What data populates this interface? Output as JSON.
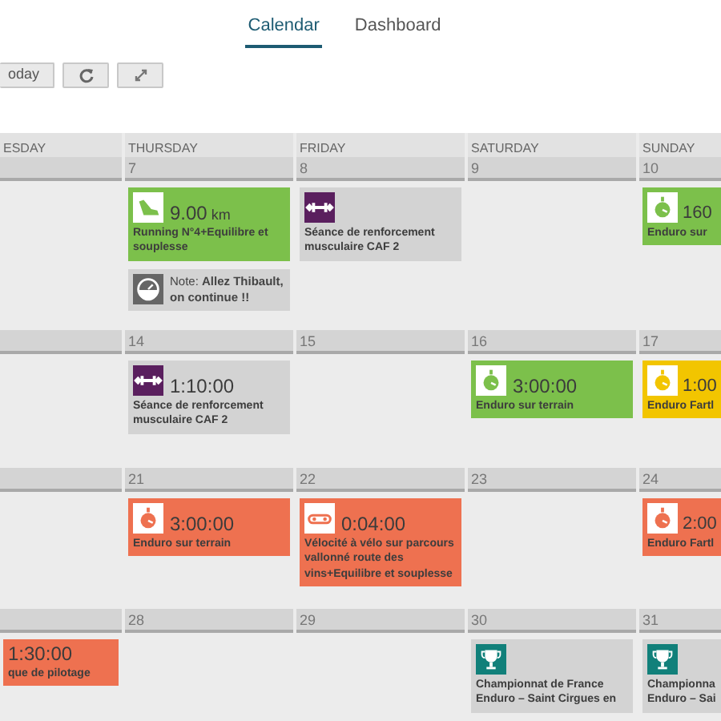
{
  "tabs": [
    {
      "label": "Calendar",
      "selected": true
    },
    {
      "label": "Dashboard",
      "selected": false
    }
  ],
  "toolbar": {
    "today_button": "oday"
  },
  "day_headers": [
    "ESDAY",
    "THURSDAY",
    "FRIDAY",
    "SATURDAY",
    "SUNDAY"
  ],
  "weeks": [
    {
      "days": [
        {
          "date": "7",
          "events": [
            {
              "kind": "running",
              "color": "#7cc04b",
              "value": "9.00",
              "unit": "km",
              "title": "Running N°4+Equilibre et souplesse"
            },
            {
              "kind": "note",
              "color": "#d3d3d3",
              "title": "Note: **Allez Thibault, on continue !!**"
            }
          ]
        },
        {
          "date": "8",
          "events": [
            {
              "kind": "strength",
              "color": "#d3d3d3",
              "title": "Séance de renforcement musculaire CAF 2"
            }
          ]
        },
        {
          "date": "9"
        },
        {
          "date": "10",
          "events": [
            {
              "kind": "enduro",
              "color": "#7cc04b",
              "value": "160",
              "title": "Enduro sur"
            }
          ]
        }
      ]
    },
    {
      "days": [
        {
          "date": "14",
          "events": [
            {
              "kind": "strength",
              "color": "#d3d3d3",
              "value": "1:10:00",
              "title": "Séance de renforcement musculaire CAF 2"
            }
          ]
        },
        {
          "date": "15"
        },
        {
          "date": "16",
          "events": [
            {
              "kind": "enduro",
              "color": "#7cc04b",
              "value": "3:00:00",
              "title": "Enduro sur terrain"
            }
          ]
        },
        {
          "date": "17",
          "events": [
            {
              "kind": "enduro",
              "color": "#f2c500",
              "value": "1:00",
              "title": "Enduro Fartl"
            }
          ]
        }
      ]
    },
    {
      "days": [
        {
          "date": "21",
          "events": [
            {
              "kind": "enduro",
              "color": "#ee7150",
              "value": "3:00:00",
              "title": "Enduro sur terrain"
            }
          ]
        },
        {
          "date": "22",
          "events": [
            {
              "kind": "cycling",
              "color": "#ee7150",
              "value": "0:04:00",
              "title": "Vélocité à vélo sur parcours vallonné route des vins+Equilibre et souplesse"
            }
          ]
        },
        {
          "date": "23"
        },
        {
          "date": "24",
          "events": [
            {
              "kind": "enduro",
              "color": "#ee7150",
              "value": "2:00",
              "title": "Enduro Fartl"
            }
          ]
        }
      ]
    },
    {
      "cut_off_day": {
        "events": [
          {
            "kind": "plain",
            "color": "#ee7150",
            "value": "1:30:00",
            "title": "que de pilotage"
          }
        ]
      },
      "days": [
        {
          "date": "28"
        },
        {
          "date": "29"
        },
        {
          "date": "30",
          "events": [
            {
              "kind": "race",
              "color": "#d3d3d3",
              "title": "Championnat de France Enduro – Saint Cirgues en"
            }
          ]
        },
        {
          "date": "31",
          "events": [
            {
              "kind": "race",
              "color": "#d3d3d3",
              "title": "Championna\nEnduro – Sai"
            }
          ]
        }
      ]
    }
  ]
}
